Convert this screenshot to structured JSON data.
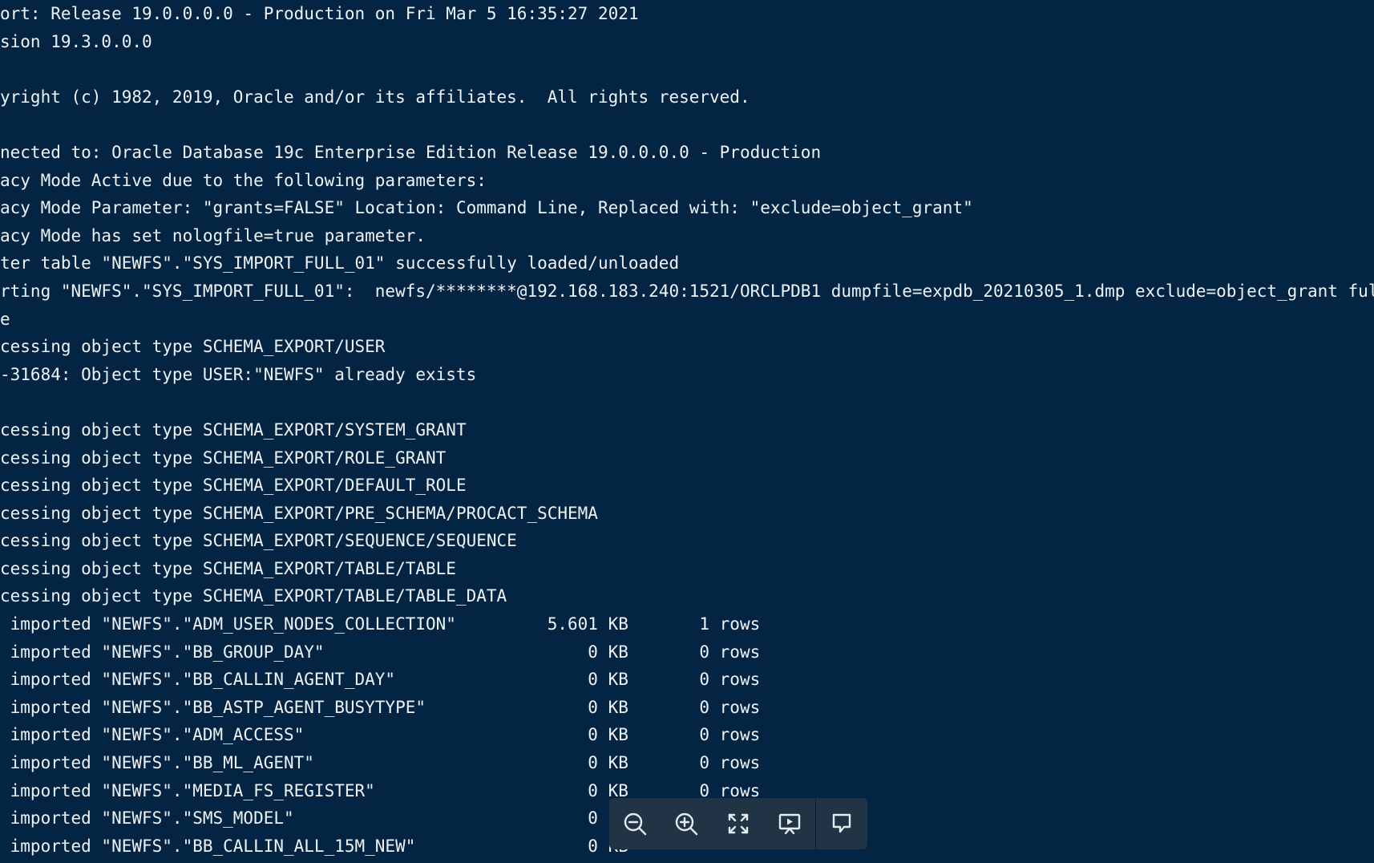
{
  "terminal": {
    "lines": [
      "ort: Release 19.0.0.0.0 - Production on Fri Mar 5 16:35:27 2021",
      "sion 19.3.0.0.0",
      "",
      "yright (c) 1982, 2019, Oracle and/or its affiliates.  All rights reserved.",
      "",
      "nected to: Oracle Database 19c Enterprise Edition Release 19.0.0.0.0 - Production",
      "acy Mode Active due to the following parameters:",
      "acy Mode Parameter: \"grants=FALSE\" Location: Command Line, Replaced with: \"exclude=object_grant\"",
      "acy Mode has set nologfile=true parameter.",
      "ter table \"NEWFS\".\"SYS_IMPORT_FULL_01\" successfully loaded/unloaded",
      "rting \"NEWFS\".\"SYS_IMPORT_FULL_01\":  newfs/********@192.168.183.240:1521/ORCLPDB1 dumpfile=expdb_20210305_1.dmp exclude=object_grant full=y n",
      "e",
      "cessing object type SCHEMA_EXPORT/USER",
      "-31684: Object type USER:\"NEWFS\" already exists",
      "",
      "cessing object type SCHEMA_EXPORT/SYSTEM_GRANT",
      "cessing object type SCHEMA_EXPORT/ROLE_GRANT",
      "cessing object type SCHEMA_EXPORT/DEFAULT_ROLE",
      "cessing object type SCHEMA_EXPORT/PRE_SCHEMA/PROCACT_SCHEMA",
      "cessing object type SCHEMA_EXPORT/SEQUENCE/SEQUENCE",
      "cessing object type SCHEMA_EXPORT/TABLE/TABLE",
      "cessing object type SCHEMA_EXPORT/TABLE/TABLE_DATA",
      " imported \"NEWFS\".\"ADM_USER_NODES_COLLECTION\"         5.601 KB       1 rows",
      " imported \"NEWFS\".\"BB_GROUP_DAY\"                          0 KB       0 rows",
      " imported \"NEWFS\".\"BB_CALLIN_AGENT_DAY\"                   0 KB       0 rows",
      " imported \"NEWFS\".\"BB_ASTP_AGENT_BUSYTYPE\"                0 KB       0 rows",
      " imported \"NEWFS\".\"ADM_ACCESS\"                            0 KB       0 rows",
      " imported \"NEWFS\".\"BB_ML_AGENT\"                           0 KB       0 rows",
      " imported \"NEWFS\".\"MEDIA_FS_REGISTER\"                     0 KB       0 rows",
      " imported \"NEWFS\".\"SMS_MODEL\"                             0 KB",
      " imported \"NEWFS\".\"BB_CALLIN_ALL_15M_NEW\"                 0 KB"
    ]
  },
  "toolbar": {
    "buttons": [
      {
        "name": "zoom-out-button",
        "icon": "zoom-out-icon"
      },
      {
        "name": "zoom-in-button",
        "icon": "zoom-in-icon"
      },
      {
        "name": "fullscreen-button",
        "icon": "fullscreen-icon"
      },
      {
        "name": "presentation-button",
        "icon": "presentation-icon"
      },
      {
        "name": "comment-button",
        "icon": "comment-icon"
      }
    ]
  },
  "colors": {
    "background": "#032543",
    "text": "#eef2f6",
    "toolbar_background": "#213446",
    "toolbar_icon": "#e6ebf0"
  }
}
